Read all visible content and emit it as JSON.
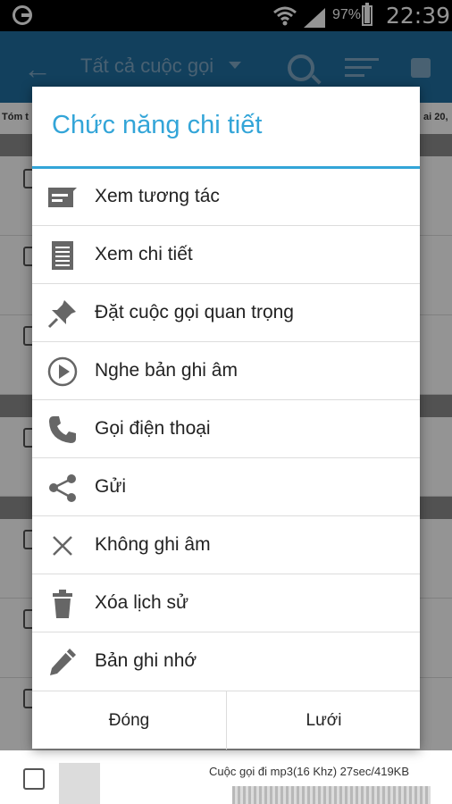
{
  "status": {
    "battery_pct": "97%",
    "time": "22:39"
  },
  "appbar": {
    "title": "Tất cả cuộc gọi"
  },
  "background": {
    "summary_left": "Tóm t",
    "summary_right": "ai 20,",
    "bottom_item_meta": "Cuộc gọi đi  mp3(16 Khz)  27sec/419KB"
  },
  "dialog": {
    "title": "Chức năng chi tiết",
    "items": [
      {
        "label": "Xem tương tác",
        "icon": "message-icon"
      },
      {
        "label": "Xem chi tiết",
        "icon": "document-icon"
      },
      {
        "label": "Đặt cuộc gọi quan trọng",
        "icon": "pin-icon"
      },
      {
        "label": "Nghe bản ghi âm",
        "icon": "play-icon"
      },
      {
        "label": "Gọi điện thoại",
        "icon": "phone-icon"
      },
      {
        "label": "Gửi",
        "icon": "share-icon"
      },
      {
        "label": "Không ghi âm",
        "icon": "close-icon"
      },
      {
        "label": "Xóa lịch sử",
        "icon": "trash-icon"
      },
      {
        "label": "Bản ghi nhớ",
        "icon": "pencil-icon"
      }
    ],
    "buttons": {
      "close": "Đóng",
      "grid": "Lưới"
    }
  }
}
